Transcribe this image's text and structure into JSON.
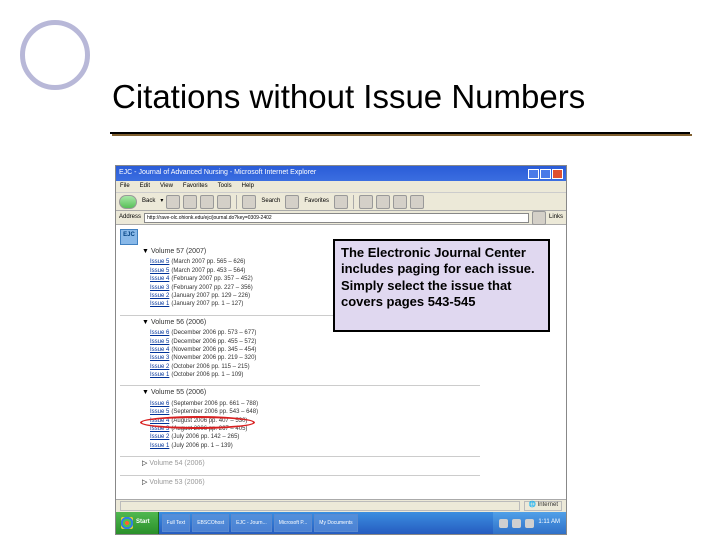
{
  "slide": {
    "title": "Citations without Issue Numbers"
  },
  "browser": {
    "window_title": "EJC - Journal of Advanced Nursing - Microsoft Internet Explorer",
    "menu": {
      "file": "File",
      "edit": "Edit",
      "view": "View",
      "favorites": "Favorites",
      "tools": "Tools",
      "help": "Help"
    },
    "toolbar": {
      "back": "Back",
      "search": "Search",
      "favorites": "Favorites"
    },
    "address_label": "Address",
    "address_value": "http://rave-olc.ohionk.edu/ejc/journal.do?key=0309-2402",
    "links_label": "Links",
    "status_internet": "Internet"
  },
  "ejc": {
    "logo": "EJC",
    "volumes": [
      {
        "label": "Volume 57 (2007)",
        "issues": [
          {
            "link": "Issue 5",
            "meta": "(March 2007 pp. 565 – 626)"
          },
          {
            "link": "Issue 5",
            "meta": "(March 2007 pp. 453 – 564)"
          },
          {
            "link": "Issue 4",
            "meta": "(February 2007 pp. 357 – 452)"
          },
          {
            "link": "Issue 3",
            "meta": "(February 2007 pp. 227 – 356)"
          },
          {
            "link": "Issue 2",
            "meta": "(January 2007 pp. 129 – 226)"
          },
          {
            "link": "Issue 1",
            "meta": "(January 2007 pp. 1 – 127)"
          }
        ]
      },
      {
        "label": "Volume 56 (2006)",
        "issues": [
          {
            "link": "Issue 6",
            "meta": "(December 2006 pp. 573 – 677)"
          },
          {
            "link": "Issue 5",
            "meta": "(December 2006 pp. 455 – 572)"
          },
          {
            "link": "Issue 4",
            "meta": "(November 2006 pp. 345 – 454)"
          },
          {
            "link": "Issue 3",
            "meta": "(November 2006 pp. 219 – 320)"
          },
          {
            "link": "Issue 2",
            "meta": "(October 2006 pp. 115 – 215)"
          },
          {
            "link": "Issue 1",
            "meta": "(October 2006 pp. 1 – 109)"
          }
        ]
      },
      {
        "label": "Volume 55 (2006)",
        "issues": [
          {
            "link": "Issue 6",
            "meta": "(September 2006 pp. 661 – 788)"
          },
          {
            "link": "Issue 5",
            "meta": "(September 2006 pp. 543 – 648)"
          },
          {
            "link": "Issue 4",
            "meta": "(August 2006 pp. 407 – 530)"
          },
          {
            "link": "Issue 3",
            "meta": "(August 2006 pp. 267 – 405)"
          },
          {
            "link": "Issue 2",
            "meta": "(July 2006 pp. 142 – 265)"
          },
          {
            "link": "Issue 1",
            "meta": "(July 2006 pp. 1 – 139)"
          }
        ]
      }
    ],
    "muted_volumes": [
      "Volume 54 (2006)",
      "Volume 53 (2006)"
    ]
  },
  "callout": {
    "text": "The Electronic Journal Center includes paging for each issue.  Simply select the issue that covers pages 543-545"
  },
  "taskbar": {
    "start": "Start",
    "items": [
      "Full Text",
      "EBSCOhost",
      "EJC - Journ...",
      "Microsoft P...",
      "My Documents"
    ],
    "clock": "1:11 AM"
  }
}
